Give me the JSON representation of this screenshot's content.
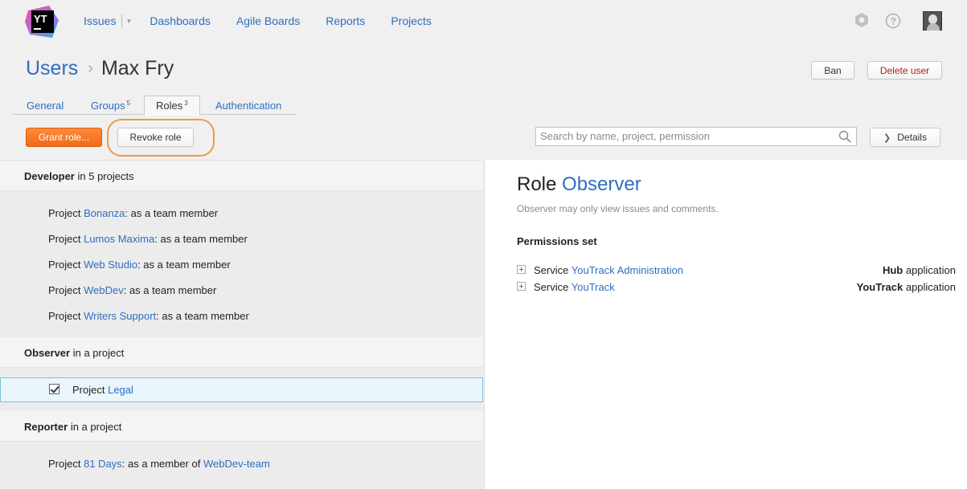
{
  "colors": {
    "link": "#2f6ebf",
    "accent_orange": "#f06b15",
    "danger": "#b51a1a",
    "selection_border": "#7cc0e0"
  },
  "header": {
    "logo_text": "YT",
    "nav": [
      {
        "label": "Issues"
      },
      {
        "label": "Dashboards"
      },
      {
        "label": "Agile Boards"
      },
      {
        "label": "Reports"
      },
      {
        "label": "Projects"
      }
    ],
    "icons": [
      "settings-icon",
      "help-icon",
      "user-avatar"
    ]
  },
  "page": {
    "breadcrumb": "Users",
    "separator": "›",
    "user_name": "Max Fry",
    "ban_label": "Ban",
    "delete_label": "Delete user"
  },
  "tabs": [
    {
      "label": "General",
      "count": ""
    },
    {
      "label": "Groups",
      "count": "5"
    },
    {
      "label": "Roles",
      "count": "3",
      "active": true
    },
    {
      "label": "Authentication",
      "count": ""
    }
  ],
  "toolbar": {
    "grant_label": "Grant role...",
    "revoke_label": "Revoke role",
    "search_placeholder": "Search by name, project, permission",
    "details_label": "Details"
  },
  "roles": {
    "developer": {
      "name": "Developer",
      "scope": "in 5 projects",
      "items": [
        {
          "prefix": "Project",
          "project": "Bonanza",
          "suffix": ": as a team member"
        },
        {
          "prefix": "Project",
          "project": "Lumos Maxima",
          "suffix": ": as a team member"
        },
        {
          "prefix": "Project",
          "project": "Web Studio",
          "suffix": ": as a team member"
        },
        {
          "prefix": "Project",
          "project": "WebDev",
          "suffix": ": as a team member"
        },
        {
          "prefix": "Project",
          "project": "Writers Support",
          "suffix": ": as a team member"
        }
      ]
    },
    "observer": {
      "name": "Observer",
      "scope": "in a project",
      "items": [
        {
          "prefix": "Project",
          "project": "Legal",
          "checked": true
        }
      ]
    },
    "reporter": {
      "name": "Reporter",
      "scope": "in a project",
      "items": [
        {
          "prefix": "Project",
          "project": "81 Days",
          "suffix": ": as a member of",
          "group": "WebDev-team"
        }
      ]
    }
  },
  "detail": {
    "role_word": "Role",
    "role_name": "Observer",
    "description": "Observer may only view issues and comments.",
    "permissions_title": "Permissions set",
    "permissions": [
      {
        "prefix": "Service",
        "service": "YouTrack Administration",
        "app_bold": "Hub",
        "app_suffix": "application"
      },
      {
        "prefix": "Service",
        "service": "YouTrack",
        "app_bold": "YouTrack",
        "app_suffix": "application"
      }
    ]
  }
}
